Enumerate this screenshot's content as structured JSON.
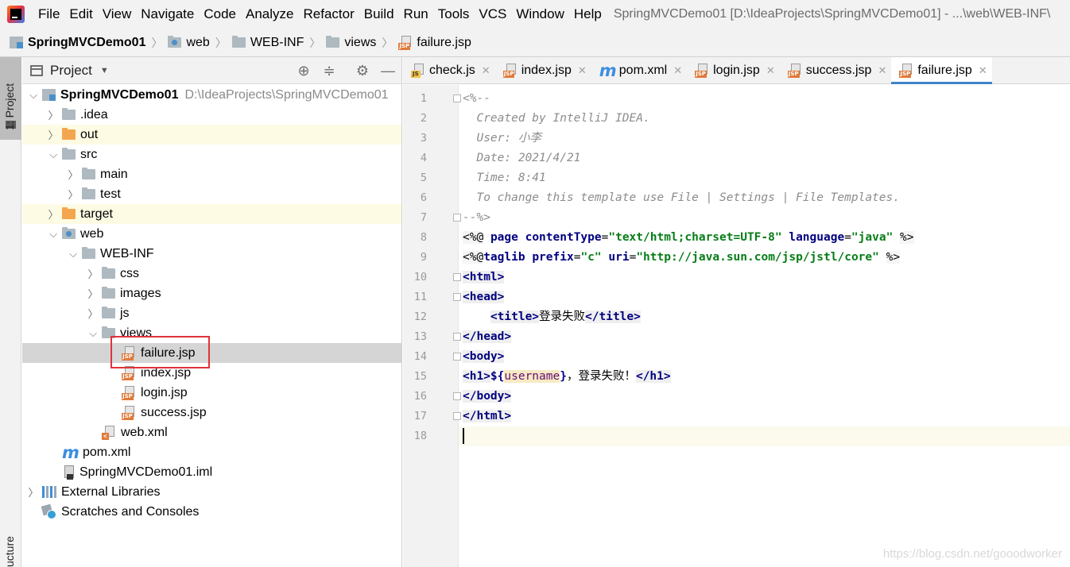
{
  "menu": {
    "items": [
      "File",
      "Edit",
      "View",
      "Navigate",
      "Code",
      "Analyze",
      "Refactor",
      "Build",
      "Run",
      "Tools",
      "VCS",
      "Window",
      "Help"
    ],
    "window_title": "SpringMVCDemo01 [D:\\IdeaProjects\\SpringMVCDemo01] - ...\\web\\WEB-INF\\"
  },
  "breadcrumb": [
    "SpringMVCDemo01",
    "web",
    "WEB-INF",
    "views",
    "failure.jsp"
  ],
  "left_strip": {
    "project_tab": "1: Project",
    "structure_tab": "ucture"
  },
  "project_panel": {
    "title": "Project",
    "tree": [
      {
        "label": "SpringMVCDemo01",
        "sub": "D:\\IdeaProjects\\SpringMVCDemo01",
        "icon": "module-icon",
        "arrow": "open",
        "depth": 0
      },
      {
        "label": ".idea",
        "icon": "folder-icon",
        "arrow": "closed",
        "depth": 1
      },
      {
        "label": "out",
        "icon": "folder-orange-icon",
        "arrow": "closed",
        "depth": 1,
        "excluded": true
      },
      {
        "label": "src",
        "icon": "folder-icon",
        "arrow": "open",
        "depth": 1
      },
      {
        "label": "main",
        "icon": "folder-icon",
        "arrow": "closed",
        "depth": 2
      },
      {
        "label": "test",
        "icon": "folder-icon",
        "arrow": "closed",
        "depth": 2
      },
      {
        "label": "target",
        "icon": "folder-orange-icon",
        "arrow": "closed",
        "depth": 1,
        "excluded": true
      },
      {
        "label": "web",
        "icon": "web-folder-icon",
        "arrow": "open",
        "depth": 1
      },
      {
        "label": "WEB-INF",
        "icon": "folder-icon",
        "arrow": "open",
        "depth": 2
      },
      {
        "label": "css",
        "icon": "folder-icon",
        "arrow": "closed",
        "depth": 3
      },
      {
        "label": "images",
        "icon": "folder-icon",
        "arrow": "closed",
        "depth": 3
      },
      {
        "label": "js",
        "icon": "folder-icon",
        "arrow": "closed",
        "depth": 3
      },
      {
        "label": "views",
        "icon": "folder-icon",
        "arrow": "open",
        "depth": 3
      },
      {
        "label": "failure.jsp",
        "icon": "jsp-file-icon",
        "arrow": "none",
        "depth": 4,
        "selected": true
      },
      {
        "label": "index.jsp",
        "icon": "jsp-file-icon",
        "arrow": "none",
        "depth": 4
      },
      {
        "label": "login.jsp",
        "icon": "jsp-file-icon",
        "arrow": "none",
        "depth": 4
      },
      {
        "label": "success.jsp",
        "icon": "jsp-file-icon",
        "arrow": "none",
        "depth": 4
      },
      {
        "label": "web.xml",
        "icon": "xml-file-icon",
        "arrow": "none",
        "depth": 3
      },
      {
        "label": "pom.xml",
        "icon": "maven-icon",
        "arrow": "none",
        "depth": 1
      },
      {
        "label": "SpringMVCDemo01.iml",
        "icon": "iml-file-icon",
        "arrow": "none",
        "depth": 1
      },
      {
        "label": "External Libraries",
        "icon": "libraries-icon",
        "arrow": "closed",
        "depth": 0
      },
      {
        "label": "Scratches and Consoles",
        "icon": "scratches-icon",
        "arrow": "none",
        "depth": 0
      }
    ]
  },
  "editor": {
    "tabs": [
      {
        "label": "check.js",
        "icon": "js-file-icon",
        "active": false
      },
      {
        "label": "index.jsp",
        "icon": "jsp-file-icon",
        "active": false
      },
      {
        "label": "pom.xml",
        "icon": "maven-icon",
        "active": false
      },
      {
        "label": "login.jsp",
        "icon": "jsp-file-icon",
        "active": false
      },
      {
        "label": "success.jsp",
        "icon": "jsp-file-icon",
        "active": false
      },
      {
        "label": "failure.jsp",
        "icon": "jsp-file-icon",
        "active": true
      }
    ],
    "current_line": 18,
    "lines": [
      "<%--",
      "  Created by IntelliJ IDEA.",
      "  User: 小李",
      "  Date: 2021/4/21",
      "  Time: 8:41",
      "  To change this template use File | Settings | File Templates.",
      "--%>",
      "<%@ page contentType=\"text/html;charset=UTF-8\" language=\"java\" %>",
      "<%@taglib prefix=\"c\" uri=\"http://java.sun.com/jsp/jstl/core\" %>",
      "<html>",
      "<head>",
      "    <title>登录失败</title>",
      "</head>",
      "<body>",
      "<h1>${username}，登录失败！</h1>",
      "</body>",
      "</html>",
      ""
    ]
  },
  "watermark": "https://blog.csdn.net/gooodworker"
}
